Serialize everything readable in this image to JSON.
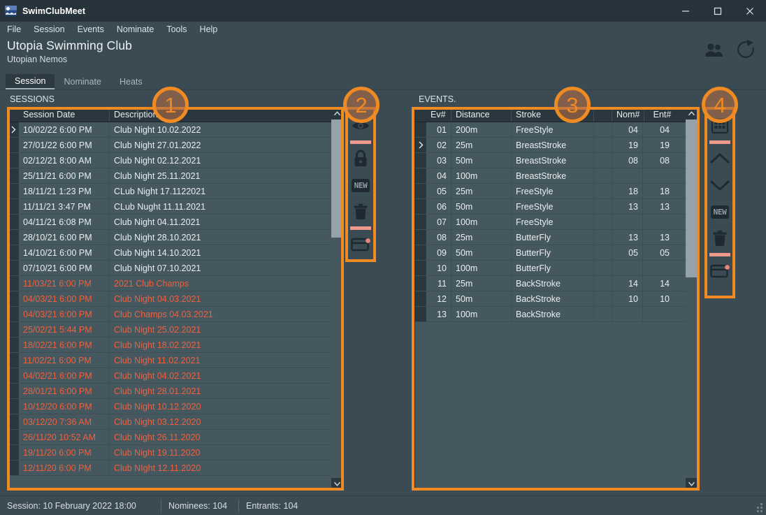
{
  "window": {
    "title": "SwimClubMeet",
    "app_icon": "swim-logo-icon",
    "minimize_label": "—",
    "maximize_label": "□",
    "close_label": "✕"
  },
  "menubar": {
    "items": [
      {
        "label": "File"
      },
      {
        "label": "Session"
      },
      {
        "label": "Events"
      },
      {
        "label": "Nominate"
      },
      {
        "label": "Tools"
      },
      {
        "label": "Help"
      }
    ]
  },
  "header": {
    "club_name": "Utopia Swimming Club",
    "club_subtitle": "Utopian Nemos",
    "actions": [
      {
        "name": "members-icon"
      },
      {
        "name": "refresh-icon"
      }
    ]
  },
  "tabs": [
    {
      "label": "Session",
      "active": true
    },
    {
      "label": "Nominate",
      "active": false
    },
    {
      "label": "Heats",
      "active": false
    }
  ],
  "sessions_panel": {
    "label": "SESSIONS",
    "columns": [
      "Session Date",
      "Description"
    ],
    "selected_row_index": 0,
    "rows": [
      {
        "date": "10/02/22 6:00 PM",
        "description": "Club Night 10.02.2022",
        "past": false,
        "selected": true
      },
      {
        "date": "27/01/22 6:00 PM",
        "description": "Club Night 27.01.2022",
        "past": false,
        "selected": false
      },
      {
        "date": "02/12/21 8:00 AM",
        "description": "Club Night 02.12.2021",
        "past": false,
        "selected": false
      },
      {
        "date": "25/11/21 6:00 PM",
        "description": "Club Night 25.11.2021",
        "past": false,
        "selected": false
      },
      {
        "date": "18/11/21 1:23 PM",
        "description": "CLub Night 17.1122021",
        "past": false,
        "selected": false
      },
      {
        "date": "11/11/21 3:47 PM",
        "description": "CLub Nught 11.11.2021",
        "past": false,
        "selected": false
      },
      {
        "date": "04/11/21 6:08 PM",
        "description": "Club Night 04.11.2021",
        "past": false,
        "selected": false
      },
      {
        "date": "28/10/21 6:00 PM",
        "description": "Club Night 28.10.2021",
        "past": false,
        "selected": false
      },
      {
        "date": "14/10/21 6:00 PM",
        "description": "Club Night 14.10.2021",
        "past": false,
        "selected": false
      },
      {
        "date": "07/10/21 6:00 PM",
        "description": "Club Night 07.10.2021",
        "past": false,
        "selected": false
      },
      {
        "date": "11/03/21 6:00 PM",
        "description": "2021 Club Champs",
        "past": true,
        "selected": false
      },
      {
        "date": "04/03/21 6:00 PM",
        "description": "Club Night 04.03.2021",
        "past": true,
        "selected": false
      },
      {
        "date": "04/03/21 6:00 PM",
        "description": "Club Champs 04.03.2021",
        "past": true,
        "selected": false
      },
      {
        "date": "25/02/21 5:44 PM",
        "description": "Club Night 25.02.2021",
        "past": true,
        "selected": false
      },
      {
        "date": "18/02/21 6:00 PM",
        "description": "Club Night 18.02.2021",
        "past": true,
        "selected": false
      },
      {
        "date": "11/02/21 6:00 PM",
        "description": "Club Night 11.02.2021",
        "past": true,
        "selected": false
      },
      {
        "date": "04/02/21 6:00 PM",
        "description": "Club Night 04.02.2021",
        "past": true,
        "selected": false
      },
      {
        "date": "28/01/21 6:00 PM",
        "description": "Club Night 28.01.2021",
        "past": true,
        "selected": false
      },
      {
        "date": "10/12/20 6:00 PM",
        "description": "Club Night 10.12.2020",
        "past": true,
        "selected": false
      },
      {
        "date": "03/12/20 7:36 AM",
        "description": "Club Night 03.12.2020",
        "past": true,
        "selected": false
      },
      {
        "date": "26/11/20 10:52 AM",
        "description": "Club Night 26.11.2020",
        "past": true,
        "selected": false
      },
      {
        "date": "19/11/20 6:00 PM",
        "description": "Club Night 19.11.2020",
        "past": true,
        "selected": false
      },
      {
        "date": "12/11/20 6:00 PM",
        "description": "Club NIght 12.11.2020",
        "past": true,
        "selected": false
      }
    ],
    "scrollbar": {
      "thumb_top_pct": 0,
      "thumb_height_pct": 33
    }
  },
  "sessions_toolbar": {
    "buttons": [
      {
        "name": "eye-icon",
        "label": ""
      },
      {
        "name": "separator",
        "label": ""
      },
      {
        "name": "lock-icon",
        "label": ""
      },
      {
        "name": "new-icon",
        "label": "NEW"
      },
      {
        "name": "trash-icon",
        "label": ""
      },
      {
        "name": "separator",
        "label": ""
      },
      {
        "name": "save-card-icon",
        "label": ""
      }
    ]
  },
  "events_panel": {
    "label": "EVENTS.",
    "columns": [
      "Ev#",
      "Distance",
      "Stroke",
      "",
      "Nom#",
      "Ent#"
    ],
    "selected_row_index": 1,
    "rows": [
      {
        "ev": "01",
        "distance": "200m",
        "stroke": "FreeStyle",
        "nom": "04",
        "ent": "04",
        "selected": false
      },
      {
        "ev": "02",
        "distance": "25m",
        "stroke": "BreastStroke",
        "nom": "19",
        "ent": "19",
        "selected": true
      },
      {
        "ev": "03",
        "distance": "50m",
        "stroke": "BreastStroke",
        "nom": "08",
        "ent": "08",
        "selected": false
      },
      {
        "ev": "04",
        "distance": "100m",
        "stroke": "BreastStroke",
        "nom": "",
        "ent": "",
        "selected": false
      },
      {
        "ev": "05",
        "distance": "25m",
        "stroke": "FreeStyle",
        "nom": "18",
        "ent": "18",
        "selected": false
      },
      {
        "ev": "06",
        "distance": "50m",
        "stroke": "FreeStyle",
        "nom": "13",
        "ent": "13",
        "selected": false
      },
      {
        "ev": "07",
        "distance": "100m",
        "stroke": "FreeStyle",
        "nom": "",
        "ent": "",
        "selected": false
      },
      {
        "ev": "08",
        "distance": "25m",
        "stroke": "ButterFly",
        "nom": "13",
        "ent": "13",
        "selected": false
      },
      {
        "ev": "09",
        "distance": "50m",
        "stroke": "ButterFly",
        "nom": "05",
        "ent": "05",
        "selected": false
      },
      {
        "ev": "10",
        "distance": "100m",
        "stroke": "ButterFly",
        "nom": "",
        "ent": "",
        "selected": false
      },
      {
        "ev": "11",
        "distance": "25m",
        "stroke": "BackStroke",
        "nom": "14",
        "ent": "14",
        "selected": false
      },
      {
        "ev": "12",
        "distance": "50m",
        "stroke": "BackStroke",
        "nom": "10",
        "ent": "10",
        "selected": false
      },
      {
        "ev": "13",
        "distance": "100m",
        "stroke": "BackStroke",
        "nom": "",
        "ent": "",
        "selected": false
      }
    ],
    "scrollbar": {
      "thumb_top_pct": 0,
      "thumb_height_pct": 44
    }
  },
  "events_toolbar": {
    "buttons": [
      {
        "name": "grid-icon",
        "label": ""
      },
      {
        "name": "separator",
        "label": ""
      },
      {
        "name": "move-up-icon",
        "label": ""
      },
      {
        "name": "move-down-icon",
        "label": ""
      },
      {
        "name": "new-icon",
        "label": "NEW"
      },
      {
        "name": "trash-icon",
        "label": ""
      },
      {
        "name": "separator",
        "label": ""
      },
      {
        "name": "save-card-icon",
        "label": ""
      }
    ]
  },
  "annotations": [
    {
      "number": "1",
      "target": "sessions-grid"
    },
    {
      "number": "2",
      "target": "sessions-toolbar"
    },
    {
      "number": "3",
      "target": "events-grid"
    },
    {
      "number": "4",
      "target": "events-toolbar"
    }
  ],
  "statusbar": {
    "session": "Session: 10 February 2022 18:00",
    "nominees": "Nominees: 104",
    "entrants": "Entrants: 104"
  },
  "colors": {
    "accent_orange": "#ef8b22",
    "past_red": "#ef603d",
    "window_bg": "#3a4b53",
    "grid_row_bg": "#46585f",
    "grid_header_bg": "#2b373e",
    "titlebar_bg": "#27333b"
  }
}
